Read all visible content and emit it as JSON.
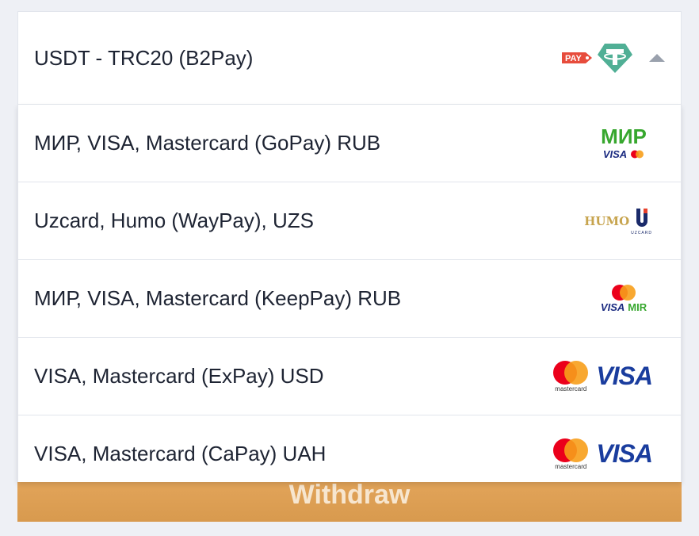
{
  "selected": {
    "label": "USDT - TRC20 (B2Pay)",
    "pay_badge": "PAY",
    "icons": [
      "pay-badge-icon",
      "tether-icon",
      "caret-up-icon"
    ]
  },
  "options": [
    {
      "label": "МИР, VISA, Mastercard (GoPay) RUB",
      "logo": "mir-visa-mastercard-logo",
      "logo_text": {
        "mir": "МИР",
        "visa": "VISA"
      }
    },
    {
      "label": "Uzcard, Humo (WayPay), UZS",
      "logo": "humo-uzcard-logo",
      "logo_text": {
        "humo": "HUMO",
        "uzcard": "UZCARD"
      }
    },
    {
      "label": "МИР, VISA, Mastercard (KeepPay) RUB",
      "logo": "mastercard-visa-mir-logo",
      "logo_text": {
        "visa": "VISA",
        "mir": "MIR"
      }
    },
    {
      "label": "VISA, Mastercard (ExPay) USD",
      "logo": "mastercard-visa-logo",
      "logo_text": {
        "mastercard": "mastercard",
        "visa": "VISA"
      }
    },
    {
      "label": "VISA, Mastercard (CaPay) UAH",
      "logo": "mastercard-visa-logo",
      "logo_text": {
        "mastercard": "mastercard",
        "visa": "VISA"
      }
    }
  ],
  "withdraw_button": {
    "label": "Withdraw"
  },
  "colors": {
    "accent": "#dea056",
    "tether": "#50af95",
    "pay_badge": "#e74c3c",
    "mir_green": "#37a72e",
    "visa_blue": "#1a3d9e",
    "mc_red": "#eb001b",
    "mc_orange": "#f79e1b"
  }
}
